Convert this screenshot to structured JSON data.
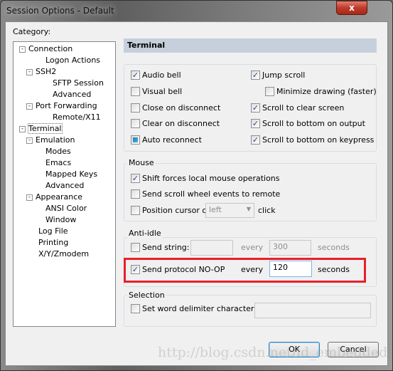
{
  "window": {
    "title": "Session Options - Default",
    "close_label": "x"
  },
  "category_label": "Category:",
  "tree": [
    {
      "label": "Connection",
      "depth": 0,
      "exp": "-"
    },
    {
      "label": "Logon Actions",
      "depth": 2,
      "exp": ""
    },
    {
      "label": "SSH2",
      "depth": 1,
      "exp": "-"
    },
    {
      "label": "SFTP Session",
      "depth": 3,
      "exp": ""
    },
    {
      "label": "Advanced",
      "depth": 3,
      "exp": ""
    },
    {
      "label": "Port Forwarding",
      "depth": 1,
      "exp": "-"
    },
    {
      "label": "Remote/X11",
      "depth": 3,
      "exp": ""
    },
    {
      "label": "Terminal",
      "depth": 0,
      "exp": "-",
      "selected": true
    },
    {
      "label": "Emulation",
      "depth": 1,
      "exp": "-"
    },
    {
      "label": "Modes",
      "depth": 2,
      "exp": ""
    },
    {
      "label": "Emacs",
      "depth": 2,
      "exp": ""
    },
    {
      "label": "Mapped Keys",
      "depth": 2,
      "exp": ""
    },
    {
      "label": "Advanced",
      "depth": 2,
      "exp": ""
    },
    {
      "label": "Appearance",
      "depth": 1,
      "exp": "-"
    },
    {
      "label": "ANSI Color",
      "depth": 2,
      "exp": ""
    },
    {
      "label": "Window",
      "depth": 2,
      "exp": ""
    },
    {
      "label": "Log File",
      "depth": 1,
      "exp": ""
    },
    {
      "label": "Printing",
      "depth": 1,
      "exp": ""
    },
    {
      "label": "X/Y/Zmodem",
      "depth": 1,
      "exp": ""
    }
  ],
  "panel_title": "Terminal",
  "terminal": {
    "audio_bell": {
      "label": "Audio bell",
      "checked": true
    },
    "visual_bell": {
      "label": "Visual bell",
      "checked": false
    },
    "close_on_disconnect": {
      "label": "Close on disconnect",
      "checked": false
    },
    "clear_on_disconnect": {
      "label": "Clear on disconnect",
      "checked": false
    },
    "auto_reconnect": {
      "label": "Auto reconnect",
      "state": "indeterminate"
    },
    "jump_scroll": {
      "label": "Jump scroll",
      "checked": true
    },
    "minimize_drawing": {
      "label": "Minimize drawing (faster)",
      "checked": false
    },
    "scroll_clear": {
      "label": "Scroll to clear screen",
      "checked": true
    },
    "scroll_output": {
      "label": "Scroll to bottom on output",
      "checked": true
    },
    "scroll_keypress": {
      "label": "Scroll to bottom on keypress",
      "checked": true
    }
  },
  "mouse": {
    "title": "Mouse",
    "shift_forces": {
      "label": "Shift forces local mouse operations",
      "checked": true
    },
    "scroll_wheel": {
      "label": "Send scroll wheel events to remote",
      "checked": false
    },
    "position_cursor": {
      "label": "Position cursor on",
      "checked": false,
      "select_value": "left",
      "suffix": "click"
    }
  },
  "anti_idle": {
    "title": "Anti-idle",
    "send_string": {
      "label": "Send string:",
      "checked": false,
      "value": "",
      "every": "every",
      "interval": "300",
      "unit": "seconds"
    },
    "noop": {
      "label": "Send protocol NO-OP",
      "checked": true,
      "every": "every",
      "interval": "120",
      "unit": "seconds"
    }
  },
  "selection": {
    "title": "Selection",
    "word_delim": {
      "label": "Set word delimiter characters:",
      "checked": false,
      "value": ""
    }
  },
  "buttons": {
    "ok": "OK",
    "cancel": "Cancel"
  },
  "watermark": "http://blog.csdn.net/ld_embedded",
  "colors": {
    "highlight": "#e8202a",
    "header": "#c5d0dc"
  }
}
